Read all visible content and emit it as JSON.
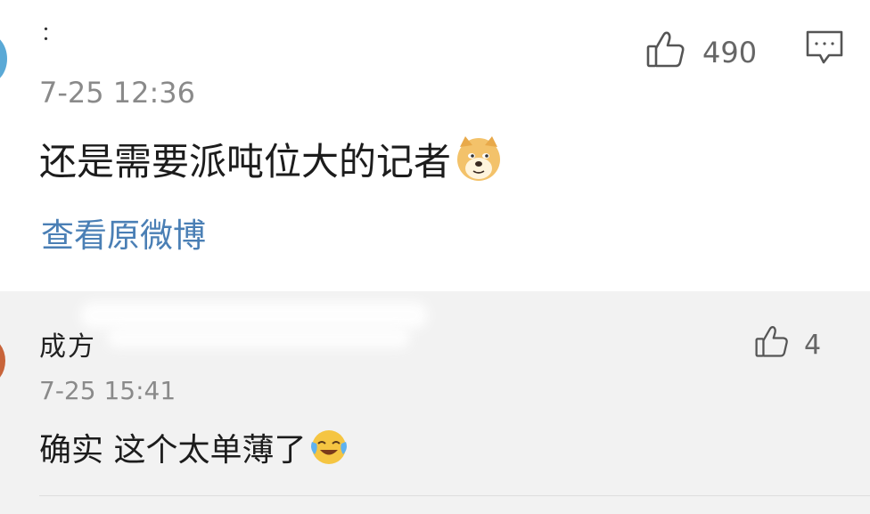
{
  "post": {
    "username": "：",
    "time": "7-25 12:36",
    "content": "还是需要派吨位大的记者",
    "content_emoji": "doge-emoji",
    "view_original": "查看原微博",
    "like_count": "490",
    "like_icon": "thumbs-up-icon",
    "comment_icon": "comment-icon"
  },
  "reply": {
    "username": "成方",
    "time": "7-25 15:41",
    "content": "确实 这个太单薄了",
    "content_emoji": "crying-laughing-emoji",
    "like_count": "4",
    "like_icon": "thumbs-up-icon"
  },
  "colors": {
    "link": "#4a7fb5",
    "timestamp": "#8a8a8a",
    "reply_bg": "#f2f2f2"
  }
}
